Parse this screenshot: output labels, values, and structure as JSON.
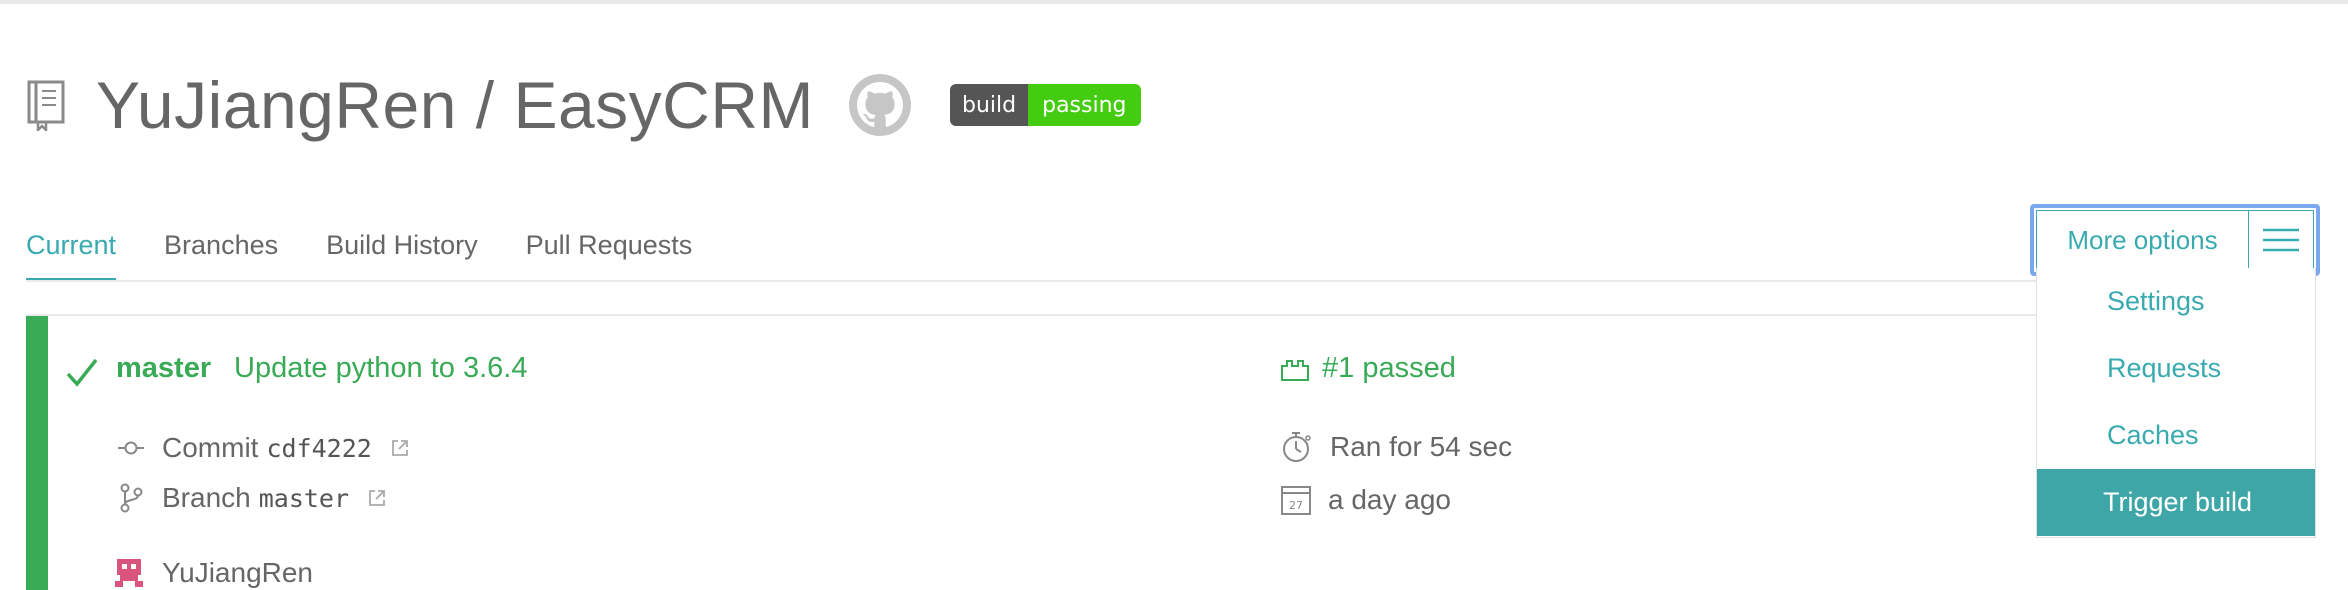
{
  "repo": {
    "owner": "YuJiangRen",
    "name": "EasyCRM",
    "title": "YuJiangRen / EasyCRM"
  },
  "badge": {
    "left": "build",
    "right": "passing",
    "left_color": "#555555",
    "right_color": "#44cc11"
  },
  "tabs": [
    {
      "label": "Current",
      "active": true
    },
    {
      "label": "Branches",
      "active": false
    },
    {
      "label": "Build History",
      "active": false
    },
    {
      "label": "Pull Requests",
      "active": false
    }
  ],
  "more_options": {
    "label": "More options",
    "menu": [
      {
        "label": "Settings"
      },
      {
        "label": "Requests"
      },
      {
        "label": "Caches"
      },
      {
        "label": "Trigger build",
        "highlighted": true
      }
    ]
  },
  "build": {
    "branch": "master",
    "message": "Update python to 3.6.4",
    "status": "#1 passed",
    "commit_label": "Commit",
    "commit_hash": "cdf4222",
    "branch_label": "Branch",
    "branch_value": "master",
    "duration": "Ran for 54 sec",
    "finished": "a day ago",
    "author": "YuJiangRen",
    "calendar_day": "27"
  },
  "colors": {
    "accent": "#39aaaf",
    "passed": "#39aa56",
    "text": "#666666",
    "focus_ring": "#7aa7ee"
  }
}
